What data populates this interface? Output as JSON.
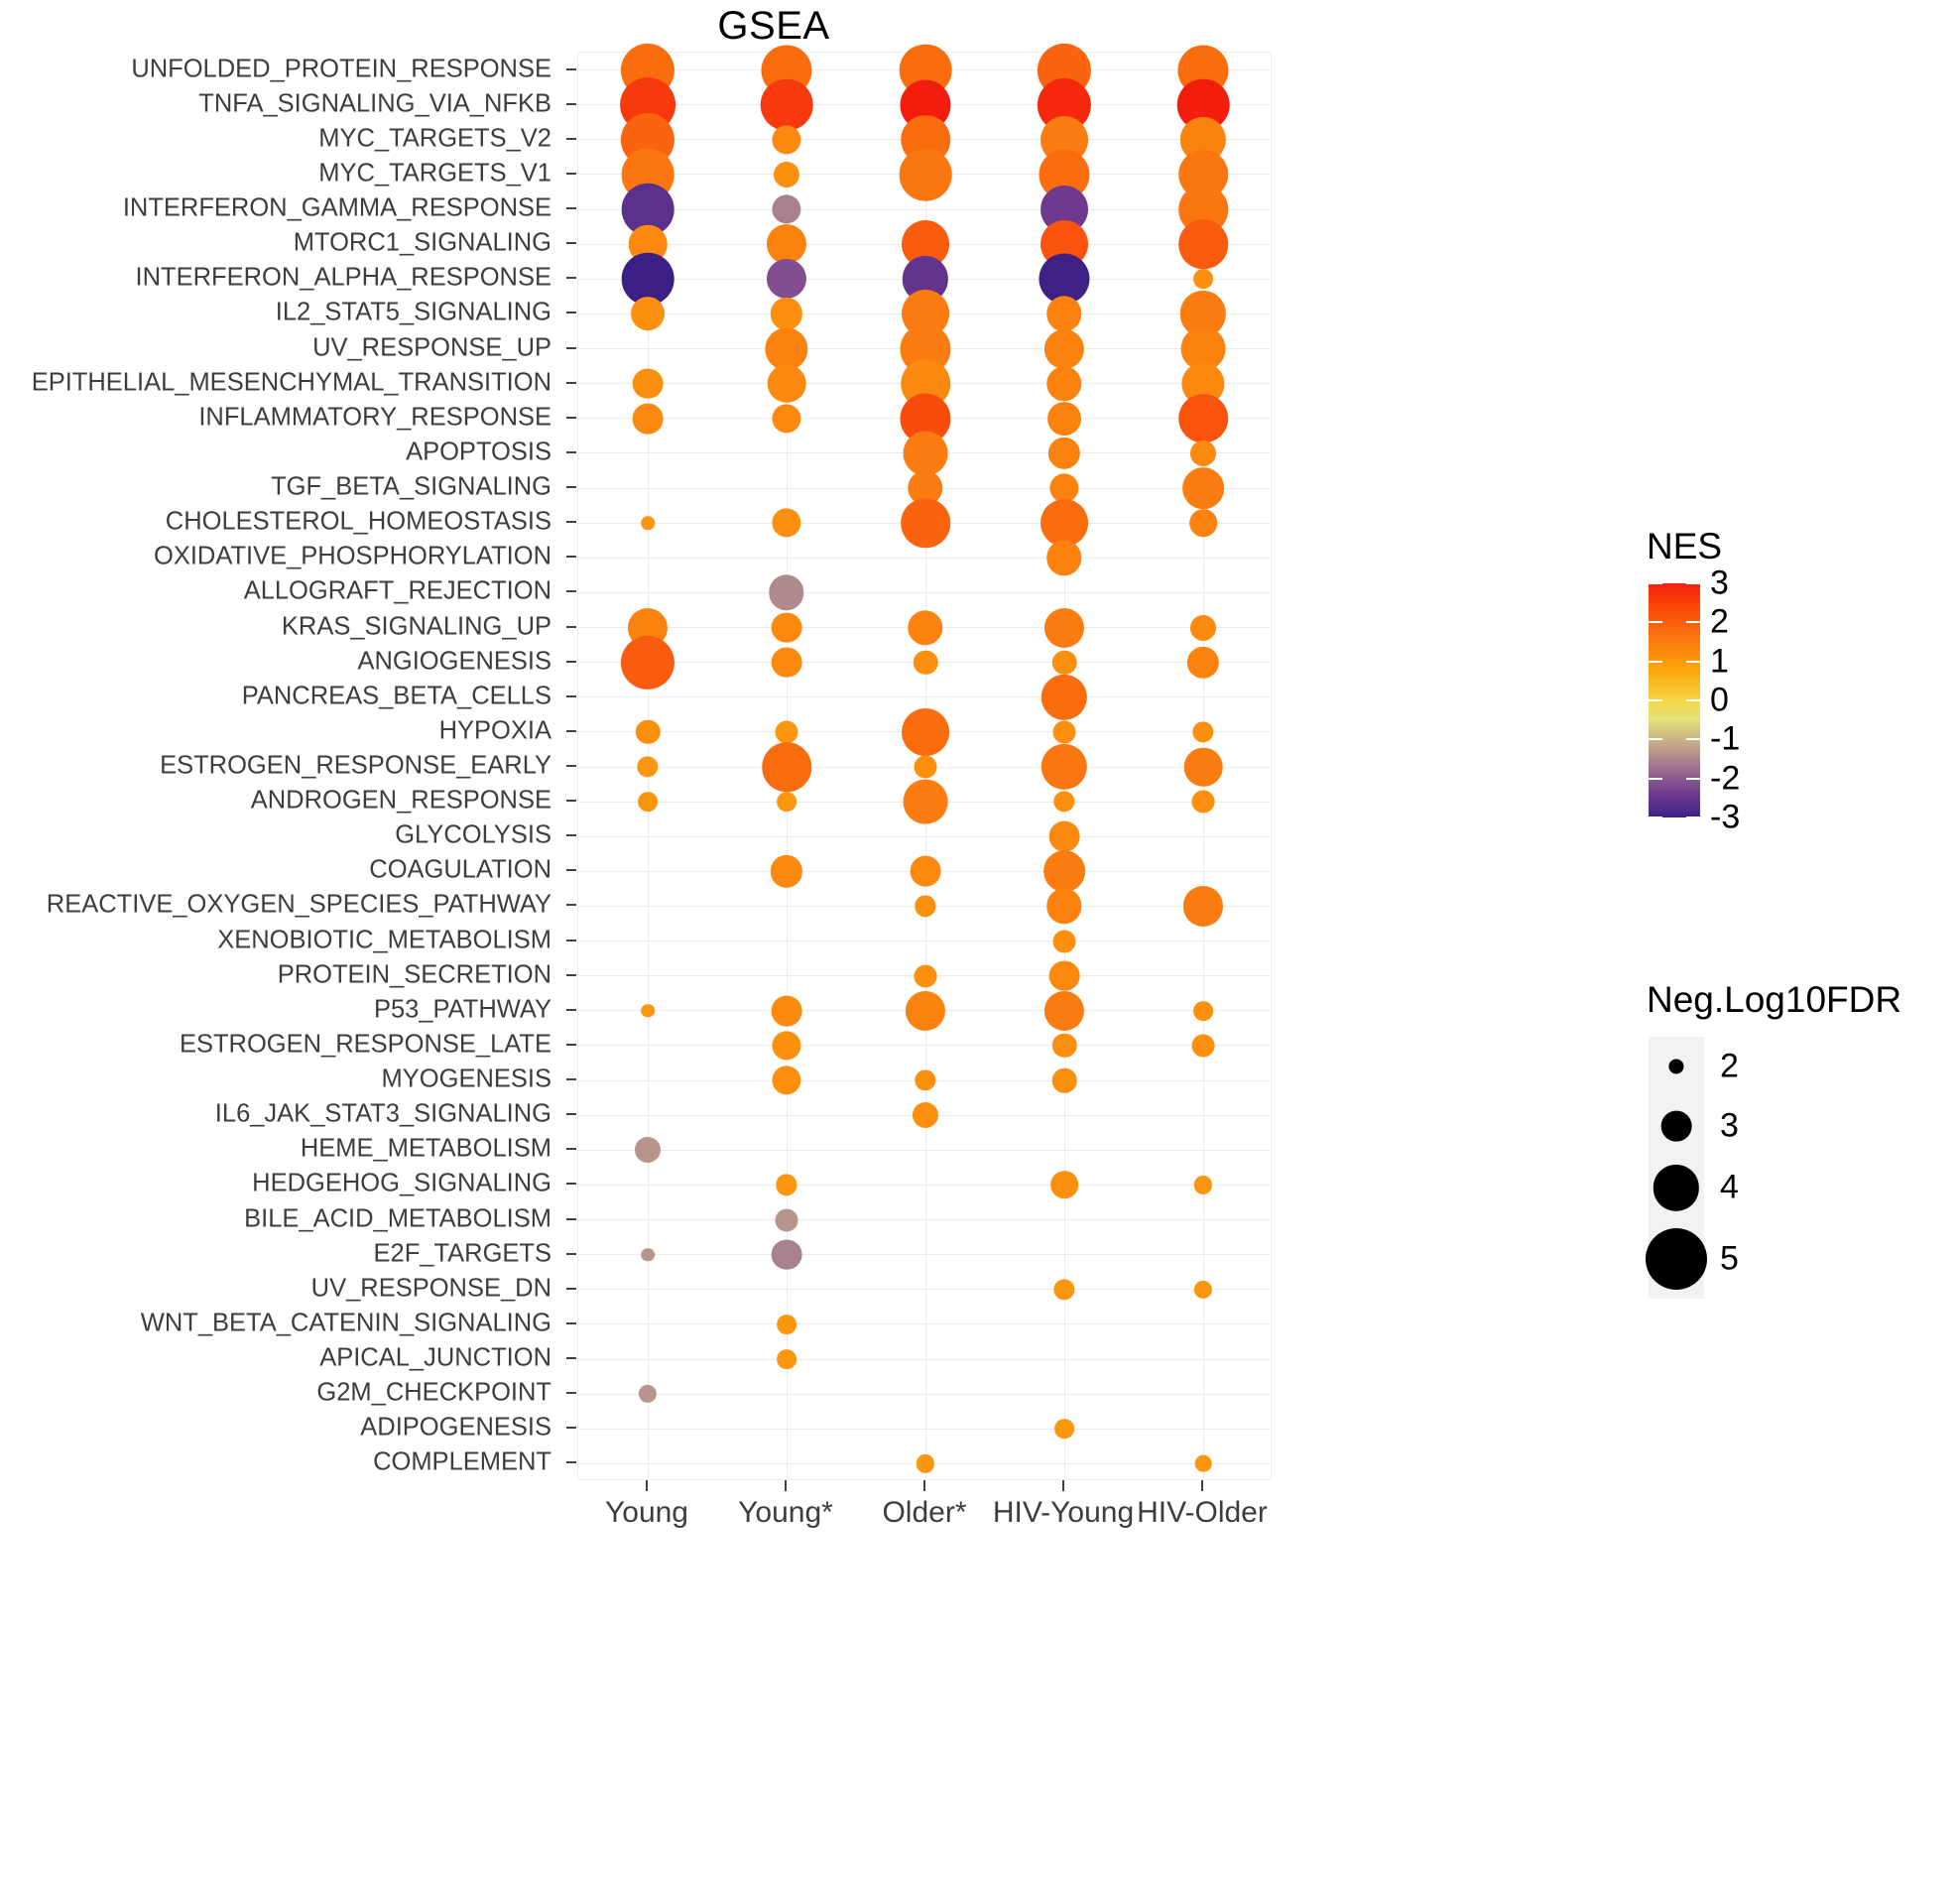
{
  "title": "GSEA",
  "legends": {
    "nes": {
      "title": "NES",
      "ticks": [
        "3",
        "2",
        "1",
        "0",
        "-1",
        "-2",
        "-3"
      ],
      "colors": {
        "pos3": "#f5210e",
        "pos2": "#fb7510",
        "pos1": "#fca50a",
        "zero": "#f6d746",
        "neg1": "#bfa08b",
        "neg2": "#8e5b90",
        "neg3": "#3b1f85"
      }
    },
    "size": {
      "title": "Neg.Log10FDR",
      "entries": [
        "2",
        "3",
        "4",
        "5"
      ]
    }
  },
  "chart_data": {
    "type": "scatter",
    "title": "GSEA",
    "xlabel": "",
    "ylabel": "",
    "grid": true,
    "legend_position": "right",
    "color_label": "NES",
    "size_label": "Neg.Log10FDR",
    "color_range": [
      -3,
      3
    ],
    "size_range": [
      2,
      5
    ],
    "categories": [
      "Young",
      "Young*",
      "Older*",
      "HIV-Young",
      "HIV-Older"
    ],
    "pathways": [
      "UNFOLDED_PROTEIN_RESPONSE",
      "TNFA_SIGNALING_VIA_NFKB",
      "MYC_TARGETS_V2",
      "MYC_TARGETS_V1",
      "INTERFERON_GAMMA_RESPONSE",
      "MTORC1_SIGNALING",
      "INTERFERON_ALPHA_RESPONSE",
      "IL2_STAT5_SIGNALING",
      "UV_RESPONSE_UP",
      "EPITHELIAL_MESENCHYMAL_TRANSITION",
      "INFLAMMATORY_RESPONSE",
      "APOPTOSIS",
      "TGF_BETA_SIGNALING",
      "CHOLESTEROL_HOMEOSTASIS",
      "OXIDATIVE_PHOSPHORYLATION",
      "ALLOGRAFT_REJECTION",
      "KRAS_SIGNALING_UP",
      "ANGIOGENESIS",
      "PANCREAS_BETA_CELLS",
      "HYPOXIA",
      "ESTROGEN_RESPONSE_EARLY",
      "ANDROGEN_RESPONSE",
      "GLYCOLYSIS",
      "COAGULATION",
      "REACTIVE_OXYGEN_SPECIES_PATHWAY",
      "XENOBIOTIC_METABOLISM",
      "PROTEIN_SECRETION",
      "P53_PATHWAY",
      "ESTROGEN_RESPONSE_LATE",
      "MYOGENESIS",
      "IL6_JAK_STAT3_SIGNALING",
      "HEME_METABOLISM",
      "HEDGEHOG_SIGNALING",
      "BILE_ACID_METABOLISM",
      "E2F_TARGETS",
      "UV_RESPONSE_DN",
      "WNT_BETA_CATENIN_SIGNALING",
      "APICAL_JUNCTION",
      "G2M_CHECKPOINT",
      "ADIPOGENESIS",
      "COMPLEMENT"
    ],
    "points": [
      {
        "pathway": "UNFOLDED_PROTEIN_RESPONSE",
        "group": "Young",
        "nes": 2.1,
        "fdr": 4.5
      },
      {
        "pathway": "UNFOLDED_PROTEIN_RESPONSE",
        "group": "Young*",
        "nes": 2.1,
        "fdr": 4.3
      },
      {
        "pathway": "UNFOLDED_PROTEIN_RESPONSE",
        "group": "Older*",
        "nes": 2.1,
        "fdr": 4.4
      },
      {
        "pathway": "UNFOLDED_PROTEIN_RESPONSE",
        "group": "HIV-Young",
        "nes": 2.2,
        "fdr": 4.5
      },
      {
        "pathway": "UNFOLDED_PROTEIN_RESPONSE",
        "group": "HIV-Older",
        "nes": 2.1,
        "fdr": 4.3
      },
      {
        "pathway": "TNFA_SIGNALING_VIA_NFKB",
        "group": "Young",
        "nes": 2.7,
        "fdr": 4.6
      },
      {
        "pathway": "TNFA_SIGNALING_VIA_NFKB",
        "group": "Young*",
        "nes": 2.7,
        "fdr": 4.4
      },
      {
        "pathway": "TNFA_SIGNALING_VIA_NFKB",
        "group": "Older*",
        "nes": 3.1,
        "fdr": 4.3
      },
      {
        "pathway": "TNFA_SIGNALING_VIA_NFKB",
        "group": "HIV-Young",
        "nes": 2.9,
        "fdr": 4.5
      },
      {
        "pathway": "TNFA_SIGNALING_VIA_NFKB",
        "group": "HIV-Older",
        "nes": 3.1,
        "fdr": 4.4
      },
      {
        "pathway": "MYC_TARGETS_V2",
        "group": "Young",
        "nes": 2.2,
        "fdr": 4.5
      },
      {
        "pathway": "MYC_TARGETS_V2",
        "group": "Young*",
        "nes": 1.7,
        "fdr": 2.9
      },
      {
        "pathway": "MYC_TARGETS_V2",
        "group": "Older*",
        "nes": 2.1,
        "fdr": 4.2
      },
      {
        "pathway": "MYC_TARGETS_V2",
        "group": "HIV-Young",
        "nes": 1.9,
        "fdr": 4.1
      },
      {
        "pathway": "MYC_TARGETS_V2",
        "group": "HIV-Older",
        "nes": 1.8,
        "fdr": 4.0
      },
      {
        "pathway": "MYC_TARGETS_V1",
        "group": "Young",
        "nes": 2.0,
        "fdr": 4.4
      },
      {
        "pathway": "MYC_TARGETS_V1",
        "group": "Young*",
        "nes": 1.6,
        "fdr": 2.7
      },
      {
        "pathway": "MYC_TARGETS_V1",
        "group": "Older*",
        "nes": 2.0,
        "fdr": 4.4
      },
      {
        "pathway": "MYC_TARGETS_V1",
        "group": "HIV-Young",
        "nes": 2.1,
        "fdr": 4.3
      },
      {
        "pathway": "MYC_TARGETS_V1",
        "group": "HIV-Older",
        "nes": 2.0,
        "fdr": 4.2
      },
      {
        "pathway": "INTERFERON_GAMMA_RESPONSE",
        "group": "Young",
        "nes": -2.3,
        "fdr": 4.4
      },
      {
        "pathway": "INTERFERON_GAMMA_RESPONSE",
        "group": "Young*",
        "nes": -1.3,
        "fdr": 2.9
      },
      {
        "pathway": "INTERFERON_GAMMA_RESPONSE",
        "group": "HIV-Young",
        "nes": -2.0,
        "fdr": 4.1
      },
      {
        "pathway": "INTERFERON_GAMMA_RESPONSE",
        "group": "HIV-Older",
        "nes": 2.0,
        "fdr": 4.2
      },
      {
        "pathway": "MTORC1_SIGNALING",
        "group": "Young",
        "nes": 1.7,
        "fdr": 3.5
      },
      {
        "pathway": "MTORC1_SIGNALING",
        "group": "Young*",
        "nes": 1.8,
        "fdr": 3.6
      },
      {
        "pathway": "MTORC1_SIGNALING",
        "group": "Older*",
        "nes": 2.3,
        "fdr": 4.1
      },
      {
        "pathway": "MTORC1_SIGNALING",
        "group": "HIV-Young",
        "nes": 2.4,
        "fdr": 4.1
      },
      {
        "pathway": "MTORC1_SIGNALING",
        "group": "HIV-Older",
        "nes": 2.3,
        "fdr": 4.2
      },
      {
        "pathway": "INTERFERON_ALPHA_RESPONSE",
        "group": "Young",
        "nes": -3.0,
        "fdr": 4.4
      },
      {
        "pathway": "INTERFERON_ALPHA_RESPONSE",
        "group": "Young*",
        "nes": -1.8,
        "fdr": 3.6
      },
      {
        "pathway": "INTERFERON_ALPHA_RESPONSE",
        "group": "Older*",
        "nes": -2.2,
        "fdr": 4.0
      },
      {
        "pathway": "INTERFERON_ALPHA_RESPONSE",
        "group": "HIV-Young",
        "nes": -2.9,
        "fdr": 4.3
      },
      {
        "pathway": "INTERFERON_ALPHA_RESPONSE",
        "group": "HIV-Older",
        "nes": 1.6,
        "fdr": 2.3
      },
      {
        "pathway": "IL2_STAT5_SIGNALING",
        "group": "Young",
        "nes": 1.6,
        "fdr": 3.2
      },
      {
        "pathway": "IL2_STAT5_SIGNALING",
        "group": "Young*",
        "nes": 1.6,
        "fdr": 3.1
      },
      {
        "pathway": "IL2_STAT5_SIGNALING",
        "group": "Older*",
        "nes": 1.9,
        "fdr": 4.1
      },
      {
        "pathway": "IL2_STAT5_SIGNALING",
        "group": "HIV-Young",
        "nes": 1.8,
        "fdr": 3.3
      },
      {
        "pathway": "IL2_STAT5_SIGNALING",
        "group": "HIV-Older",
        "nes": 1.9,
        "fdr": 4.0
      },
      {
        "pathway": "UV_RESPONSE_UP",
        "group": "Young*",
        "nes": 1.8,
        "fdr": 3.8
      },
      {
        "pathway": "UV_RESPONSE_UP",
        "group": "Older*",
        "nes": 1.9,
        "fdr": 4.3
      },
      {
        "pathway": "UV_RESPONSE_UP",
        "group": "HIV-Young",
        "nes": 1.8,
        "fdr": 3.6
      },
      {
        "pathway": "UV_RESPONSE_UP",
        "group": "HIV-Older",
        "nes": 1.8,
        "fdr": 3.9
      },
      {
        "pathway": "EPITHELIAL_MESENCHYMAL_TRANSITION",
        "group": "Young",
        "nes": 1.6,
        "fdr": 3.0
      },
      {
        "pathway": "EPITHELIAL_MESENCHYMAL_TRANSITION",
        "group": "Young*",
        "nes": 1.7,
        "fdr": 3.5
      },
      {
        "pathway": "EPITHELIAL_MESENCHYMAL_TRANSITION",
        "group": "Older*",
        "nes": 1.7,
        "fdr": 4.2
      },
      {
        "pathway": "EPITHELIAL_MESENCHYMAL_TRANSITION",
        "group": "HIV-Young",
        "nes": 1.8,
        "fdr": 3.3
      },
      {
        "pathway": "EPITHELIAL_MESENCHYMAL_TRANSITION",
        "group": "HIV-Older",
        "nes": 1.7,
        "fdr": 3.8
      },
      {
        "pathway": "INFLAMMATORY_RESPONSE",
        "group": "Young",
        "nes": 1.7,
        "fdr": 3.0
      },
      {
        "pathway": "INFLAMMATORY_RESPONSE",
        "group": "Young*",
        "nes": 1.7,
        "fdr": 2.9
      },
      {
        "pathway": "INFLAMMATORY_RESPONSE",
        "group": "Older*",
        "nes": 2.5,
        "fdr": 4.3
      },
      {
        "pathway": "INFLAMMATORY_RESPONSE",
        "group": "HIV-Young",
        "nes": 1.8,
        "fdr": 3.2
      },
      {
        "pathway": "INFLAMMATORY_RESPONSE",
        "group": "HIV-Older",
        "nes": 2.4,
        "fdr": 4.2
      },
      {
        "pathway": "APOPTOSIS",
        "group": "Older*",
        "nes": 1.9,
        "fdr": 3.9
      },
      {
        "pathway": "APOPTOSIS",
        "group": "HIV-Young",
        "nes": 1.8,
        "fdr": 3.1
      },
      {
        "pathway": "APOPTOSIS",
        "group": "HIV-Older",
        "nes": 1.7,
        "fdr": 2.7
      },
      {
        "pathway": "TGF_BETA_SIGNALING",
        "group": "Older*",
        "nes": 1.9,
        "fdr": 3.3
      },
      {
        "pathway": "TGF_BETA_SIGNALING",
        "group": "HIV-Young",
        "nes": 1.8,
        "fdr": 2.9
      },
      {
        "pathway": "TGF_BETA_SIGNALING",
        "group": "HIV-Older",
        "nes": 1.9,
        "fdr": 3.7
      },
      {
        "pathway": "CHOLESTEROL_HOMEOSTASIS",
        "group": "Young",
        "nes": 1.5,
        "fdr": 1.9
      },
      {
        "pathway": "CHOLESTEROL_HOMEOSTASIS",
        "group": "Young*",
        "nes": 1.6,
        "fdr": 2.9
      },
      {
        "pathway": "CHOLESTEROL_HOMEOSTASIS",
        "group": "Older*",
        "nes": 2.2,
        "fdr": 4.2
      },
      {
        "pathway": "CHOLESTEROL_HOMEOSTASIS",
        "group": "HIV-Young",
        "nes": 2.1,
        "fdr": 4.1
      },
      {
        "pathway": "CHOLESTEROL_HOMEOSTASIS",
        "group": "HIV-Older",
        "nes": 1.8,
        "fdr": 2.8
      },
      {
        "pathway": "OXIDATIVE_PHOSPHORYLATION",
        "group": "HIV-Young",
        "nes": 1.8,
        "fdr": 3.3
      },
      {
        "pathway": "ALLOGRAFT_REJECTION",
        "group": "Young*",
        "nes": -1.2,
        "fdr": 3.3
      },
      {
        "pathway": "KRAS_SIGNALING_UP",
        "group": "Young",
        "nes": 1.8,
        "fdr": 3.6
      },
      {
        "pathway": "KRAS_SIGNALING_UP",
        "group": "Young*",
        "nes": 1.7,
        "fdr": 3.0
      },
      {
        "pathway": "KRAS_SIGNALING_UP",
        "group": "Older*",
        "nes": 1.8,
        "fdr": 3.3
      },
      {
        "pathway": "KRAS_SIGNALING_UP",
        "group": "HIV-Young",
        "nes": 1.9,
        "fdr": 3.6
      },
      {
        "pathway": "KRAS_SIGNALING_UP",
        "group": "HIV-Older",
        "nes": 1.7,
        "fdr": 2.7
      },
      {
        "pathway": "ANGIOGENESIS",
        "group": "Young",
        "nes": 2.3,
        "fdr": 4.5
      },
      {
        "pathway": "ANGIOGENESIS",
        "group": "Young*",
        "nes": 1.7,
        "fdr": 3.0
      },
      {
        "pathway": "ANGIOGENESIS",
        "group": "Older*",
        "nes": 1.6,
        "fdr": 2.6
      },
      {
        "pathway": "ANGIOGENESIS",
        "group": "HIV-Young",
        "nes": 1.6,
        "fdr": 2.6
      },
      {
        "pathway": "ANGIOGENESIS",
        "group": "HIV-Older",
        "nes": 1.8,
        "fdr": 3.1
      },
      {
        "pathway": "PANCREAS_BETA_CELLS",
        "group": "HIV-Young",
        "nes": 2.1,
        "fdr": 4.0
      },
      {
        "pathway": "HYPOXIA",
        "group": "Young",
        "nes": 1.6,
        "fdr": 2.6
      },
      {
        "pathway": "HYPOXIA",
        "group": "Young*",
        "nes": 1.5,
        "fdr": 2.5
      },
      {
        "pathway": "HYPOXIA",
        "group": "Older*",
        "nes": 2.1,
        "fdr": 4.1
      },
      {
        "pathway": "HYPOXIA",
        "group": "HIV-Young",
        "nes": 1.6,
        "fdr": 2.5
      },
      {
        "pathway": "HYPOXIA",
        "group": "HIV-Older",
        "nes": 1.6,
        "fdr": 2.4
      },
      {
        "pathway": "ESTROGEN_RESPONSE_EARLY",
        "group": "Young",
        "nes": 1.5,
        "fdr": 2.4
      },
      {
        "pathway": "ESTROGEN_RESPONSE_EARLY",
        "group": "Young*",
        "nes": 2.1,
        "fdr": 4.2
      },
      {
        "pathway": "ESTROGEN_RESPONSE_EARLY",
        "group": "Older*",
        "nes": 1.6,
        "fdr": 2.5
      },
      {
        "pathway": "ESTROGEN_RESPONSE_EARLY",
        "group": "HIV-Young",
        "nes": 2.0,
        "fdr": 4.0
      },
      {
        "pathway": "ESTROGEN_RESPONSE_EARLY",
        "group": "HIV-Older",
        "nes": 1.9,
        "fdr": 3.5
      },
      {
        "pathway": "ANDROGEN_RESPONSE",
        "group": "Young",
        "nes": 1.5,
        "fdr": 2.3
      },
      {
        "pathway": "ANDROGEN_RESPONSE",
        "group": "Young*",
        "nes": 1.5,
        "fdr": 2.3
      },
      {
        "pathway": "ANDROGEN_RESPONSE",
        "group": "Older*",
        "nes": 1.9,
        "fdr": 3.9
      },
      {
        "pathway": "ANDROGEN_RESPONSE",
        "group": "HIV-Young",
        "nes": 1.6,
        "fdr": 2.4
      },
      {
        "pathway": "ANDROGEN_RESPONSE",
        "group": "HIV-Older",
        "nes": 1.6,
        "fdr": 2.5
      },
      {
        "pathway": "GLYCOLYSIS",
        "group": "HIV-Young",
        "nes": 1.7,
        "fdr": 3.0
      },
      {
        "pathway": "COAGULATION",
        "group": "Young*",
        "nes": 1.7,
        "fdr": 3.1
      },
      {
        "pathway": "COAGULATION",
        "group": "Older*",
        "nes": 1.7,
        "fdr": 3.0
      },
      {
        "pathway": "COAGULATION",
        "group": "HIV-Young",
        "nes": 1.9,
        "fdr": 3.7
      },
      {
        "pathway": "REACTIVE_OXYGEN_SPECIES_PATHWAY",
        "group": "Older*",
        "nes": 1.6,
        "fdr": 2.4
      },
      {
        "pathway": "REACTIVE_OXYGEN_SPECIES_PATHWAY",
        "group": "HIV-Young",
        "nes": 1.8,
        "fdr": 3.3
      },
      {
        "pathway": "REACTIVE_OXYGEN_SPECIES_PATHWAY",
        "group": "HIV-Older",
        "nes": 1.9,
        "fdr": 3.6
      },
      {
        "pathway": "XENOBIOTIC_METABOLISM",
        "group": "HIV-Young",
        "nes": 1.6,
        "fdr": 2.5
      },
      {
        "pathway": "PROTEIN_SECRETION",
        "group": "Older*",
        "nes": 1.6,
        "fdr": 2.5
      },
      {
        "pathway": "PROTEIN_SECRETION",
        "group": "HIV-Young",
        "nes": 1.7,
        "fdr": 3.0
      },
      {
        "pathway": "P53_PATHWAY",
        "group": "Young",
        "nes": 1.5,
        "fdr": 1.9
      },
      {
        "pathway": "P53_PATHWAY",
        "group": "Young*",
        "nes": 1.7,
        "fdr": 3.0
      },
      {
        "pathway": "P53_PATHWAY",
        "group": "Older*",
        "nes": 1.8,
        "fdr": 3.6
      },
      {
        "pathway": "P53_PATHWAY",
        "group": "HIV-Young",
        "nes": 1.9,
        "fdr": 3.6
      },
      {
        "pathway": "P53_PATHWAY",
        "group": "HIV-Older",
        "nes": 1.6,
        "fdr": 2.3
      },
      {
        "pathway": "ESTROGEN_RESPONSE_LATE",
        "group": "Young*",
        "nes": 1.6,
        "fdr": 2.9
      },
      {
        "pathway": "ESTROGEN_RESPONSE_LATE",
        "group": "HIV-Young",
        "nes": 1.6,
        "fdr": 2.6
      },
      {
        "pathway": "ESTROGEN_RESPONSE_LATE",
        "group": "HIV-Older",
        "nes": 1.6,
        "fdr": 2.5
      },
      {
        "pathway": "MYOGENESIS",
        "group": "Young*",
        "nes": 1.6,
        "fdr": 2.9
      },
      {
        "pathway": "MYOGENESIS",
        "group": "Older*",
        "nes": 1.6,
        "fdr": 2.4
      },
      {
        "pathway": "MYOGENESIS",
        "group": "HIV-Young",
        "nes": 1.6,
        "fdr": 2.6
      },
      {
        "pathway": "IL6_JAK_STAT3_SIGNALING",
        "group": "Older*",
        "nes": 1.6,
        "fdr": 2.7
      },
      {
        "pathway": "HEME_METABOLISM",
        "group": "Young",
        "nes": -1.1,
        "fdr": 2.7
      },
      {
        "pathway": "HEDGEHOG_SIGNALING",
        "group": "Young*",
        "nes": 1.5,
        "fdr": 2.4
      },
      {
        "pathway": "HEDGEHOG_SIGNALING",
        "group": "HIV-Young",
        "nes": 1.6,
        "fdr": 2.8
      },
      {
        "pathway": "HEDGEHOG_SIGNALING",
        "group": "HIV-Older",
        "nes": 1.5,
        "fdr": 2.2
      },
      {
        "pathway": "BILE_ACID_METABOLISM",
        "group": "Young*",
        "nes": -1.1,
        "fdr": 2.5
      },
      {
        "pathway": "E2F_TARGETS",
        "group": "Young",
        "nes": -1.1,
        "fdr": 1.9
      },
      {
        "pathway": "E2F_TARGETS",
        "group": "Young*",
        "nes": -1.3,
        "fdr": 3.0
      },
      {
        "pathway": "UV_RESPONSE_DN",
        "group": "HIV-Young",
        "nes": 1.5,
        "fdr": 2.4
      },
      {
        "pathway": "UV_RESPONSE_DN",
        "group": "HIV-Older",
        "nes": 1.5,
        "fdr": 2.2
      },
      {
        "pathway": "WNT_BETA_CATENIN_SIGNALING",
        "group": "Young*",
        "nes": 1.5,
        "fdr": 2.3
      },
      {
        "pathway": "APICAL_JUNCTION",
        "group": "Young*",
        "nes": 1.5,
        "fdr": 2.3
      },
      {
        "pathway": "G2M_CHECKPOINT",
        "group": "Young",
        "nes": -1.1,
        "fdr": 2.2
      },
      {
        "pathway": "ADIPOGENESIS",
        "group": "HIV-Young",
        "nes": 1.5,
        "fdr": 2.3
      },
      {
        "pathway": "COMPLEMENT",
        "group": "Older*",
        "nes": 1.5,
        "fdr": 2.2
      },
      {
        "pathway": "COMPLEMENT",
        "group": "HIV-Older",
        "nes": 1.5,
        "fdr": 2.1
      }
    ]
  }
}
